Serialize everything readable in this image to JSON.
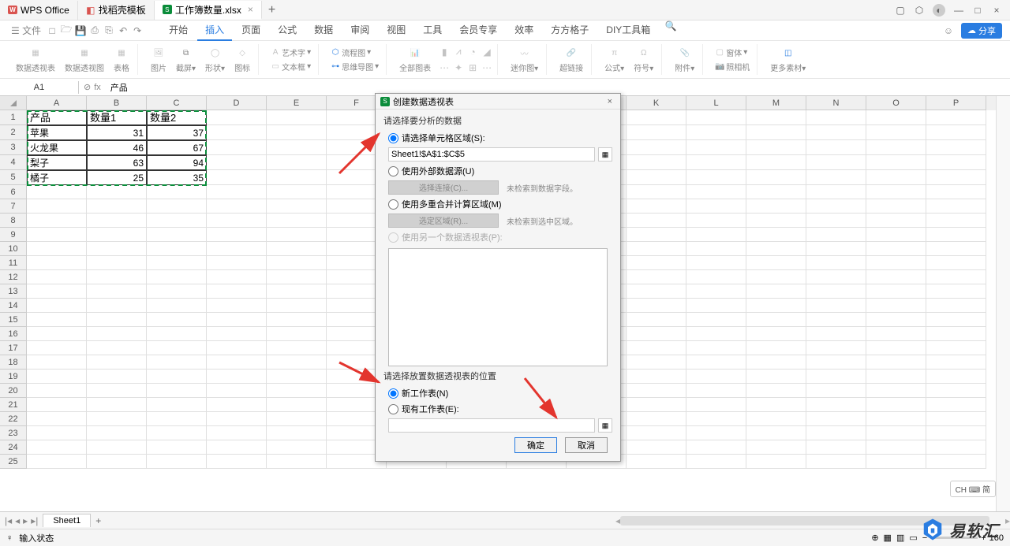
{
  "titlebar": {
    "tabs": [
      {
        "icon": "wps",
        "label": "WPS Office"
      },
      {
        "icon": "doc-red",
        "label": "找稻壳模板"
      },
      {
        "icon": "sheet-green",
        "label": "工作簿数量.xlsx",
        "active": true
      }
    ],
    "add": "+"
  },
  "menubar": {
    "file": "文件",
    "qat_icons": [
      "new-icon",
      "open-icon",
      "save-icon",
      "print-icon",
      "preview-icon",
      "undo-icon",
      "redo-icon"
    ],
    "tabs": [
      "开始",
      "插入",
      "页面",
      "公式",
      "数据",
      "审阅",
      "视图",
      "工具",
      "会员专享",
      "效率",
      "方方格子",
      "DIY工具箱"
    ],
    "active_tab": "插入",
    "share": "分享"
  },
  "ribbon": {
    "groups": [
      {
        "items": [
          {
            "label": "数据透视表"
          },
          {
            "label": "数据透视图"
          },
          {
            "label": "表格"
          }
        ]
      },
      {
        "items": [
          {
            "label": "图片"
          },
          {
            "label": "截屏",
            "drop": true
          },
          {
            "label": "形状",
            "drop": true
          },
          {
            "label": "图标"
          }
        ]
      },
      {
        "items": [
          {
            "label": "艺术字",
            "sm": true,
            "drop": true
          },
          {
            "label": "文本框",
            "sm": true,
            "drop": true
          },
          {
            "label": "流程图",
            "sm": true,
            "drop": true
          },
          {
            "label": "思维导图",
            "sm": true,
            "drop": true
          }
        ]
      },
      {
        "items": [
          {
            "label": "全部图表"
          },
          {
            "label": "",
            "icons": true
          }
        ]
      },
      {
        "items": [
          {
            "label": "迷你图",
            "drop": true
          }
        ]
      },
      {
        "items": [
          {
            "label": "超链接"
          }
        ]
      },
      {
        "items": [
          {
            "label": "公式",
            "drop": true
          },
          {
            "label": "符号",
            "drop": true
          }
        ]
      },
      {
        "items": [
          {
            "label": "附件",
            "drop": true
          }
        ]
      },
      {
        "items": [
          {
            "label": "窗体",
            "sm": true,
            "drop": true
          },
          {
            "label": "照相机",
            "sm": true
          }
        ]
      },
      {
        "items": [
          {
            "label": "更多素材",
            "drop": true
          }
        ]
      }
    ]
  },
  "formulabar": {
    "namebox": "A1",
    "fx": "fx",
    "value": "产品"
  },
  "columns": [
    "A",
    "B",
    "C",
    "D",
    "E",
    "F",
    "G",
    "H",
    "I",
    "J",
    "K",
    "L",
    "M",
    "N",
    "O",
    "P"
  ],
  "row_count": 25,
  "data": {
    "headers": [
      "产品",
      "数量1",
      "数量2"
    ],
    "rows": [
      [
        "苹果",
        "31",
        "37"
      ],
      [
        "火龙果",
        "46",
        "67"
      ],
      [
        "梨子",
        "63",
        "94"
      ],
      [
        "橘子",
        "25",
        "35"
      ]
    ]
  },
  "sheettabs": {
    "active": "Sheet1"
  },
  "statusbar": {
    "left": "输入状态",
    "zoom": "160"
  },
  "dialog": {
    "title": "创建数据透视表",
    "section1": "请选择要分析的数据",
    "r1": "请选择单元格区域(S):",
    "r1_value": "Sheet1!$A$1:$C$5",
    "r2": "使用外部数据源(U)",
    "r2_btn": "选择连接(C)...",
    "r2_hint": "未检索到数据字段。",
    "r3": "使用多重合并计算区域(M)",
    "r3_btn": "选定区域(R)...",
    "r3_hint": "未检索到选中区域。",
    "r4": "使用另一个数据透视表(P):",
    "section2": "请选择放置数据透视表的位置",
    "r5": "新工作表(N)",
    "r6": "现有工作表(E):",
    "ok": "确定",
    "cancel": "取消"
  },
  "ime": "CH ⌨ 简",
  "watermark": "易软汇"
}
